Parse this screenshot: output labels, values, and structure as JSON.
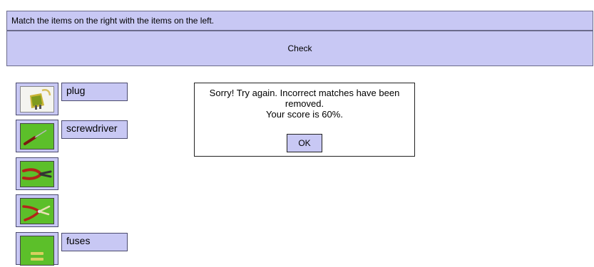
{
  "instructions": "Match the items on the right with the items on the left.",
  "check_label": "Check",
  "items": [
    {
      "picture": "plug-icon",
      "label": "plug"
    },
    {
      "picture": "screwdriver-icon",
      "label": "screwdriver"
    },
    {
      "picture": "pliers-icon",
      "label": ""
    },
    {
      "picture": "wire-strippers-icon",
      "label": ""
    },
    {
      "picture": "fuses-icon",
      "label": "fuses"
    }
  ],
  "dialog": {
    "line1": "Sorry! Try again. Incorrect matches have been",
    "line2": "removed.",
    "line3": "Your score is 60%.",
    "ok_label": "OK"
  },
  "colors": {
    "panel": "#c8c8f4",
    "photo_green": "#5cbf2a"
  }
}
